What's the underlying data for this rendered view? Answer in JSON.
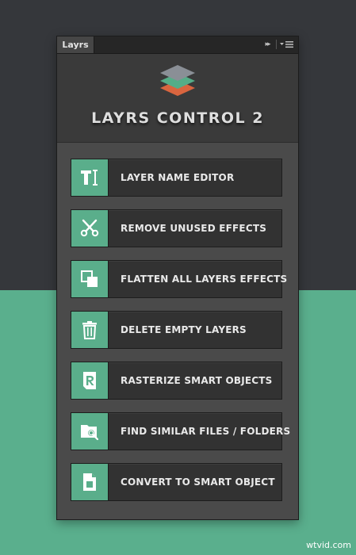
{
  "panel": {
    "tab_label": "Layrs",
    "collapse_glyph": "▸▸",
    "menu_icon": "panel-menu-icon"
  },
  "header": {
    "title": "LAYRS CONTROL 2",
    "logo_icon": "layers-stack-logo"
  },
  "actions": [
    {
      "label": "LAYER NAME EDITOR",
      "icon": "text-cursor-icon"
    },
    {
      "label": "REMOVE UNUSED EFFECTS",
      "icon": "scissors-icon"
    },
    {
      "label": "FLATTEN ALL LAYERS EFFECTS",
      "icon": "flatten-layers-icon"
    },
    {
      "label": "DELETE EMPTY LAYERS",
      "icon": "trash-icon"
    },
    {
      "label": "RASTERIZE SMART OBJECTS",
      "icon": "rasterize-icon"
    },
    {
      "label": "FIND SIMILAR FILES  / FOLDERS",
      "icon": "folder-search-icon"
    },
    {
      "label": "CONVERT TO SMART OBJECT",
      "icon": "smart-object-file-icon"
    }
  ],
  "colors": {
    "accent": "#5aae8b",
    "panel_bg": "#4a4a4a",
    "button_bg": "#323232",
    "page_top": "#35373b",
    "page_bottom": "#5aaf8d"
  },
  "watermark": "wtvid.com"
}
